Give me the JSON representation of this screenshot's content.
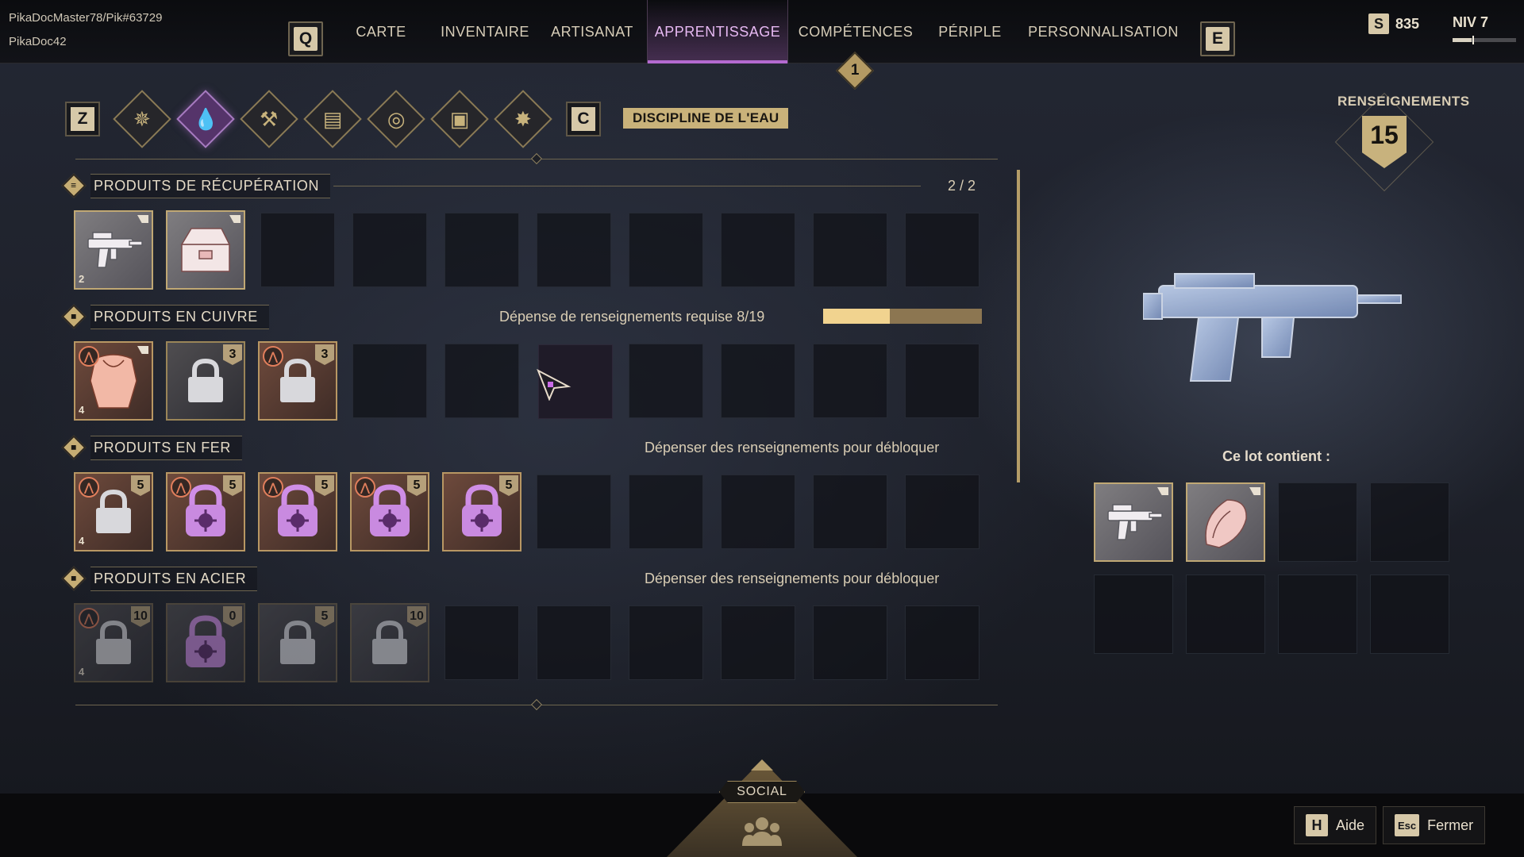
{
  "user": {
    "account": "PikaDocMaster78/Pik#63729",
    "character": "PikaDoc42"
  },
  "nav": {
    "left_key": "Q",
    "right_key": "E",
    "tabs": [
      {
        "label": "CARTE"
      },
      {
        "label": "INVENTAIRE"
      },
      {
        "label": "ARTISANAT"
      },
      {
        "label": "APPRENTISSAGE",
        "active": true
      },
      {
        "label": "COMPÉTENCES"
      },
      {
        "label": "PÉRIPLE"
      },
      {
        "label": "PERSONNALISATION"
      }
    ],
    "skills_badge": "1"
  },
  "header_right": {
    "currency_icon": "S",
    "currency": "835",
    "level": "NIV 7",
    "level_progress": 0.3
  },
  "disciplines": {
    "prev_key": "Z",
    "next_key": "C",
    "icons": [
      "compass-icon",
      "water-drop-icon",
      "crossed-tools-icon",
      "ingots-icon",
      "target-icon",
      "backpack-icon",
      "splat-icon"
    ],
    "active_index": 1,
    "title": "DISCIPLINE DE L'EAU"
  },
  "sections": [
    {
      "title": "PRODUITS DE RÉCUPÉRATION",
      "right_text": "2 / 2",
      "items": [
        {
          "art": "gun",
          "stack": "2",
          "corner": true
        },
        {
          "art": "crate",
          "corner": true
        }
      ]
    },
    {
      "title": "PRODUITS EN CUIVRE",
      "right_text": "Dépense de renseignements requise 8/19",
      "progress": 0.4211,
      "items": [
        {
          "art": "armor",
          "rank": true,
          "corner": true,
          "stack": "4"
        },
        {
          "art": "lock",
          "count": "3"
        },
        {
          "art": "lock",
          "rank": true,
          "count": "3"
        }
      ]
    },
    {
      "title": "PRODUITS EN FER",
      "right_text": "Dépenser des renseignements pour débloquer",
      "items": [
        {
          "art": "lock",
          "rank": true,
          "count": "5",
          "stack": "4"
        },
        {
          "art": "purple-lock",
          "rank": true,
          "count": "5"
        },
        {
          "art": "purple-lock",
          "rank": true,
          "count": "5"
        },
        {
          "art": "purple-lock",
          "rank": true,
          "count": "5"
        },
        {
          "art": "purple-lock",
          "count": "5"
        }
      ]
    },
    {
      "title": "PRODUITS EN ACIER",
      "right_text": "Dépenser des renseignements pour débloquer",
      "items": [
        {
          "art": "lock",
          "rank": true,
          "count": "10",
          "stack": "4"
        },
        {
          "art": "purple-lock",
          "count": "0"
        },
        {
          "art": "lock",
          "count": "5"
        },
        {
          "art": "lock",
          "count": "10"
        }
      ]
    }
  ],
  "panel": {
    "intel_title": "RENSEIGNEMENTS",
    "intel_value": "15",
    "lot_label": "Ce lot contient :",
    "lot_items": [
      {
        "art": "gun"
      },
      {
        "art": "shell"
      }
    ]
  },
  "bottom": {
    "social": "SOCIAL",
    "help_key": "H",
    "help_label": "Aide",
    "close_key": "Esc",
    "close_label": "Fermer"
  }
}
